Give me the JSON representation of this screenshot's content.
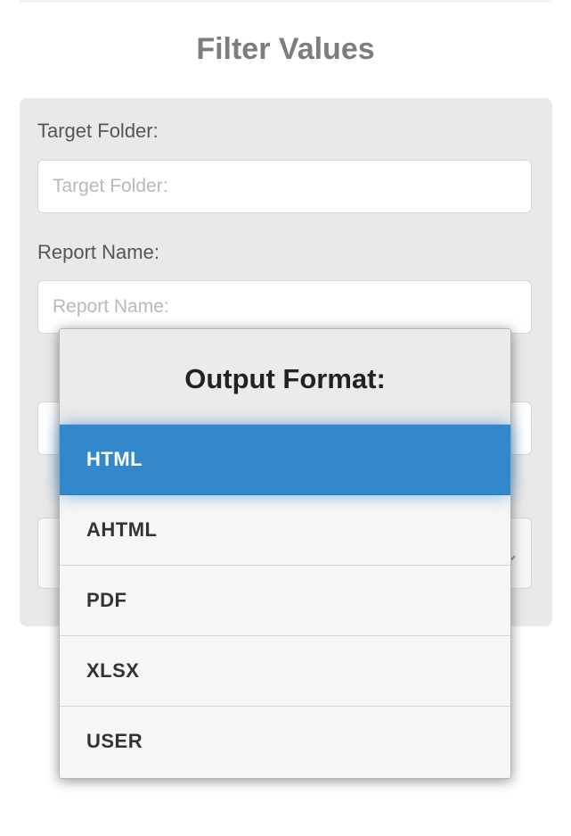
{
  "page": {
    "title": "Filter Values"
  },
  "form": {
    "target_folder": {
      "label": "Target Folder:",
      "placeholder": "Target Folder:",
      "value": ""
    },
    "report_name": {
      "label": "Report Name:",
      "placeholder": "Report Name:",
      "value": ""
    }
  },
  "popup": {
    "title": "Output Format:",
    "options": [
      {
        "label": "HTML",
        "selected": true
      },
      {
        "label": "AHTML",
        "selected": false
      },
      {
        "label": "PDF",
        "selected": false
      },
      {
        "label": "XLSX",
        "selected": false
      },
      {
        "label": "USER",
        "selected": false
      }
    ]
  },
  "colors": {
    "accent": "#3388cc",
    "panel_bg": "#e9e9e9",
    "title": "#7d7d7d"
  }
}
